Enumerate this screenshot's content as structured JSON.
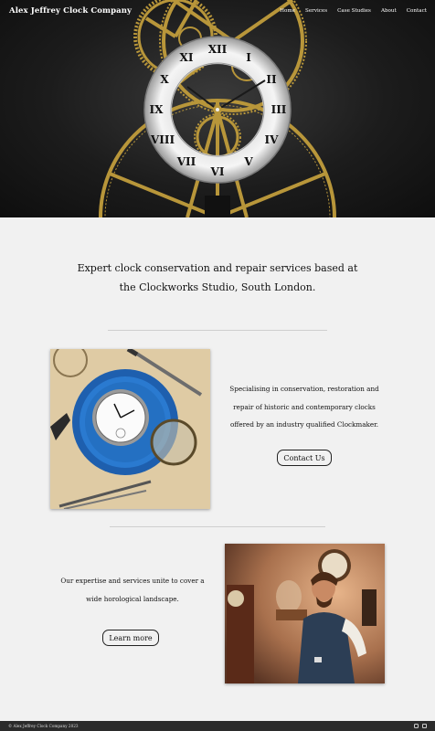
{
  "header": {
    "brand": "Alex Jeffrey Clock Company",
    "nav": [
      "Home",
      "Services",
      "Case Studies",
      "About",
      "Contact"
    ],
    "hero_image": "skeleton-clock-gears"
  },
  "intro": {
    "lines": [
      "Expert clock conservation and repair services based at",
      "the Clockworks Studio, South London."
    ]
  },
  "feature1": {
    "image": "pocket-watch-repair-tray",
    "lines": [
      "Specialising in conservation, restoration and",
      "repair of historic and contemporary clocks",
      "offered by an industry qualified Clockmaker."
    ],
    "button": "Contact Us"
  },
  "feature2": {
    "image": "clockmaker-portrait",
    "lines": [
      "Our expertise and services unite to cover a",
      "wide horological landscape."
    ],
    "button": "Learn more"
  },
  "footer": {
    "copyright": "© Alex Jeffrey Clock Company 2023",
    "icons": [
      "instagram-icon",
      "linkedin-icon"
    ]
  },
  "colors": {
    "background": "#f1f1f1",
    "footer": "#2b2b2b",
    "brass": "#b8963a"
  }
}
